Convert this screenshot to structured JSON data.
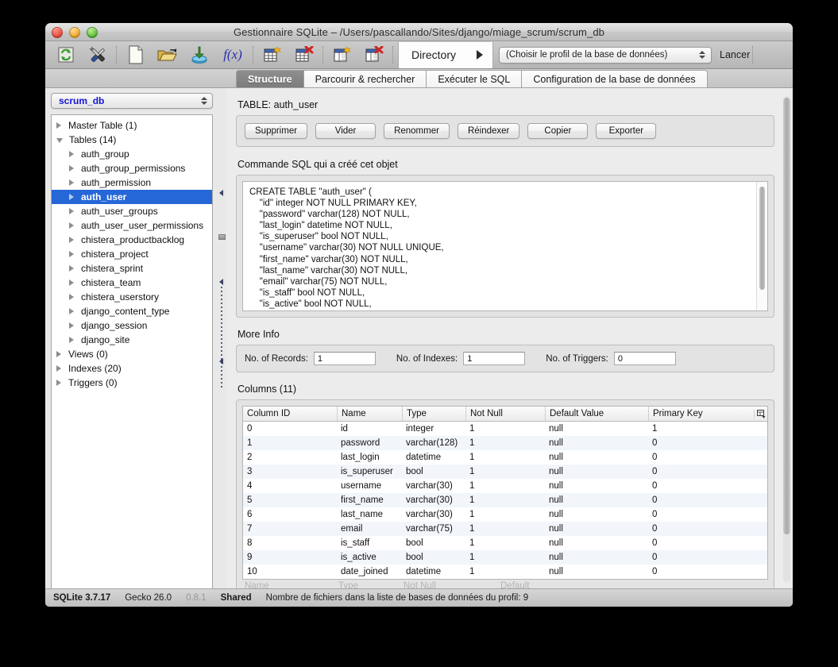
{
  "window": {
    "title": "Gestionnaire SQLite – /Users/pascallando/Sites/django/miage_scrum/scrum_db"
  },
  "toolbar": {
    "icons": [
      {
        "name": "refresh-icon",
        "glyph": "⟳"
      },
      {
        "name": "tools-icon",
        "glyph": "✖"
      },
      {
        "name": "new-document-icon",
        "glyph": "▢"
      },
      {
        "name": "open-folder-icon",
        "glyph": "▤"
      },
      {
        "name": "import-database-icon",
        "glyph": "⬇"
      },
      {
        "name": "function-icon",
        "glyph": "f(x)"
      },
      {
        "name": "new-table-icon",
        "glyph": "▦"
      },
      {
        "name": "drop-table-icon",
        "glyph": "▦"
      },
      {
        "name": "new-view-icon",
        "glyph": "▥"
      },
      {
        "name": "drop-view-icon",
        "glyph": "▥"
      }
    ],
    "fx_label": "f(x)",
    "directory_label": "Directory",
    "profile_select_value": "(Choisir le profil de la base de données)",
    "run_label": "Lancer"
  },
  "tabs": [
    {
      "label": "Structure",
      "active": true
    },
    {
      "label": "Parcourir & rechercher",
      "active": false
    },
    {
      "label": "Exécuter le SQL",
      "active": false
    },
    {
      "label": "Configuration de la base de données",
      "active": false
    }
  ],
  "sidebar": {
    "database_combo_value": "scrum_db",
    "tree": [
      {
        "label": "Master Table (1)",
        "level": 1,
        "expanded": false,
        "selected": false
      },
      {
        "label": "Tables (14)",
        "level": 1,
        "expanded": true,
        "selected": false
      },
      {
        "label": "auth_group",
        "level": 2,
        "expanded": false,
        "selected": false
      },
      {
        "label": "auth_group_permissions",
        "level": 2,
        "expanded": false,
        "selected": false
      },
      {
        "label": "auth_permission",
        "level": 2,
        "expanded": false,
        "selected": false
      },
      {
        "label": "auth_user",
        "level": 2,
        "expanded": false,
        "selected": true
      },
      {
        "label": "auth_user_groups",
        "level": 2,
        "expanded": false,
        "selected": false
      },
      {
        "label": "auth_user_user_permissions",
        "level": 2,
        "expanded": false,
        "selected": false
      },
      {
        "label": "chistera_productbacklog",
        "level": 2,
        "expanded": false,
        "selected": false
      },
      {
        "label": "chistera_project",
        "level": 2,
        "expanded": false,
        "selected": false
      },
      {
        "label": "chistera_sprint",
        "level": 2,
        "expanded": false,
        "selected": false
      },
      {
        "label": "chistera_team",
        "level": 2,
        "expanded": false,
        "selected": false
      },
      {
        "label": "chistera_userstory",
        "level": 2,
        "expanded": false,
        "selected": false
      },
      {
        "label": "django_content_type",
        "level": 2,
        "expanded": false,
        "selected": false
      },
      {
        "label": "django_session",
        "level": 2,
        "expanded": false,
        "selected": false
      },
      {
        "label": "django_site",
        "level": 2,
        "expanded": false,
        "selected": false
      },
      {
        "label": "Views (0)",
        "level": 1,
        "expanded": false,
        "selected": false
      },
      {
        "label": "Indexes (20)",
        "level": 1,
        "expanded": false,
        "selected": false
      },
      {
        "label": "Triggers (0)",
        "level": 1,
        "expanded": false,
        "selected": false
      }
    ]
  },
  "main": {
    "table_heading": "TABLE: auth_user",
    "actions": [
      "Supprimer",
      "Vider",
      "Renommer",
      "Réindexer",
      "Copier",
      "Exporter"
    ],
    "sql_section_title": "Commande SQL qui a créé cet objet",
    "sql_text": "CREATE TABLE \"auth_user\" (\n    \"id\" integer NOT NULL PRIMARY KEY,\n    \"password\" varchar(128) NOT NULL,\n    \"last_login\" datetime NOT NULL,\n    \"is_superuser\" bool NOT NULL,\n    \"username\" varchar(30) NOT NULL UNIQUE,\n    \"first_name\" varchar(30) NOT NULL,\n    \"last_name\" varchar(30) NOT NULL,\n    \"email\" varchar(75) NOT NULL,\n    \"is_staff\" bool NOT NULL,\n    \"is_active\" bool NOT NULL,",
    "more_info_title": "More Info",
    "more_info": [
      {
        "label": "No. of Records:",
        "value": "1"
      },
      {
        "label": "No. of Indexes:",
        "value": "1"
      },
      {
        "label": "No. of Triggers:",
        "value": "0"
      }
    ],
    "columns_title": "Columns (11)",
    "grid": {
      "headers": [
        "Column ID",
        "Name",
        "Type",
        "Not Null",
        "Default Value",
        "Primary Key"
      ],
      "rows": [
        [
          "0",
          "id",
          "integer",
          "1",
          "null",
          "1"
        ],
        [
          "1",
          "password",
          "varchar(128)",
          "1",
          "null",
          "0"
        ],
        [
          "2",
          "last_login",
          "datetime",
          "1",
          "null",
          "0"
        ],
        [
          "3",
          "is_superuser",
          "bool",
          "1",
          "null",
          "0"
        ],
        [
          "4",
          "username",
          "varchar(30)",
          "1",
          "null",
          "0"
        ],
        [
          "5",
          "first_name",
          "varchar(30)",
          "1",
          "null",
          "0"
        ],
        [
          "6",
          "last_name",
          "varchar(30)",
          "1",
          "null",
          "0"
        ],
        [
          "7",
          "email",
          "varchar(75)",
          "1",
          "null",
          "0"
        ],
        [
          "8",
          "is_staff",
          "bool",
          "1",
          "null",
          "0"
        ],
        [
          "9",
          "is_active",
          "bool",
          "1",
          "null",
          "0"
        ],
        [
          "10",
          "date_joined",
          "datetime",
          "1",
          "null",
          "0"
        ]
      ],
      "ghost_row": [
        "Name",
        "Type",
        "Not Null",
        "Default"
      ]
    }
  },
  "statusbar": {
    "sqlite_version": "SQLite 3.7.17",
    "gecko_version": "Gecko 26.0",
    "app_version": "0.8.1",
    "shared_label": "Shared",
    "message": "Nombre de fichiers dans la liste de bases de données du profil: 9"
  }
}
